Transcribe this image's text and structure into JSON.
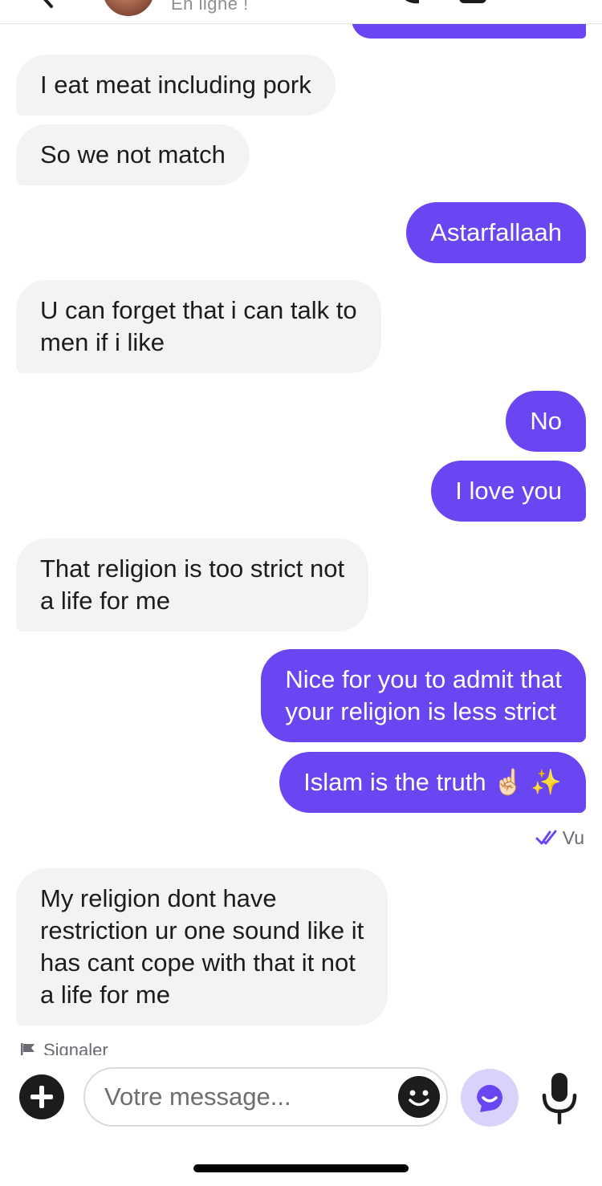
{
  "header": {
    "status": "En ligne !"
  },
  "messages": [
    {
      "side": "in",
      "lines": [
        "I eat meat including pork"
      ]
    },
    {
      "side": "in",
      "lines": [
        "So we not match"
      ]
    },
    {
      "side": "out",
      "lines": [
        "Astarfallaah"
      ]
    },
    {
      "side": "in",
      "lines": [
        "U can forget that i can talk to",
        "men if i like"
      ]
    },
    {
      "side": "out",
      "lines": [
        "No"
      ]
    },
    {
      "side": "out",
      "lines": [
        "I love you"
      ]
    },
    {
      "side": "in",
      "lines": [
        "That religion is too strict not",
        "a life for me"
      ]
    },
    {
      "side": "out",
      "lines": [
        "Nice for you to admit that",
        "your religion is less strict"
      ]
    },
    {
      "side": "out",
      "lines": [
        "Islam is the truth ☝🏻 ✨"
      ]
    },
    {
      "side": "in",
      "lines": [
        "My religion dont have",
        "restriction ur one sound like it",
        "has cant cope with that it not",
        "a life for me"
      ]
    }
  ],
  "read_receipt": "Vu",
  "report_label": "Signaler",
  "composer": {
    "placeholder": "Votre message..."
  },
  "colors": {
    "outgoing_bubble": "#6a45f2",
    "incoming_bubble": "#f3f3f5",
    "accent": "#6a45f2"
  }
}
